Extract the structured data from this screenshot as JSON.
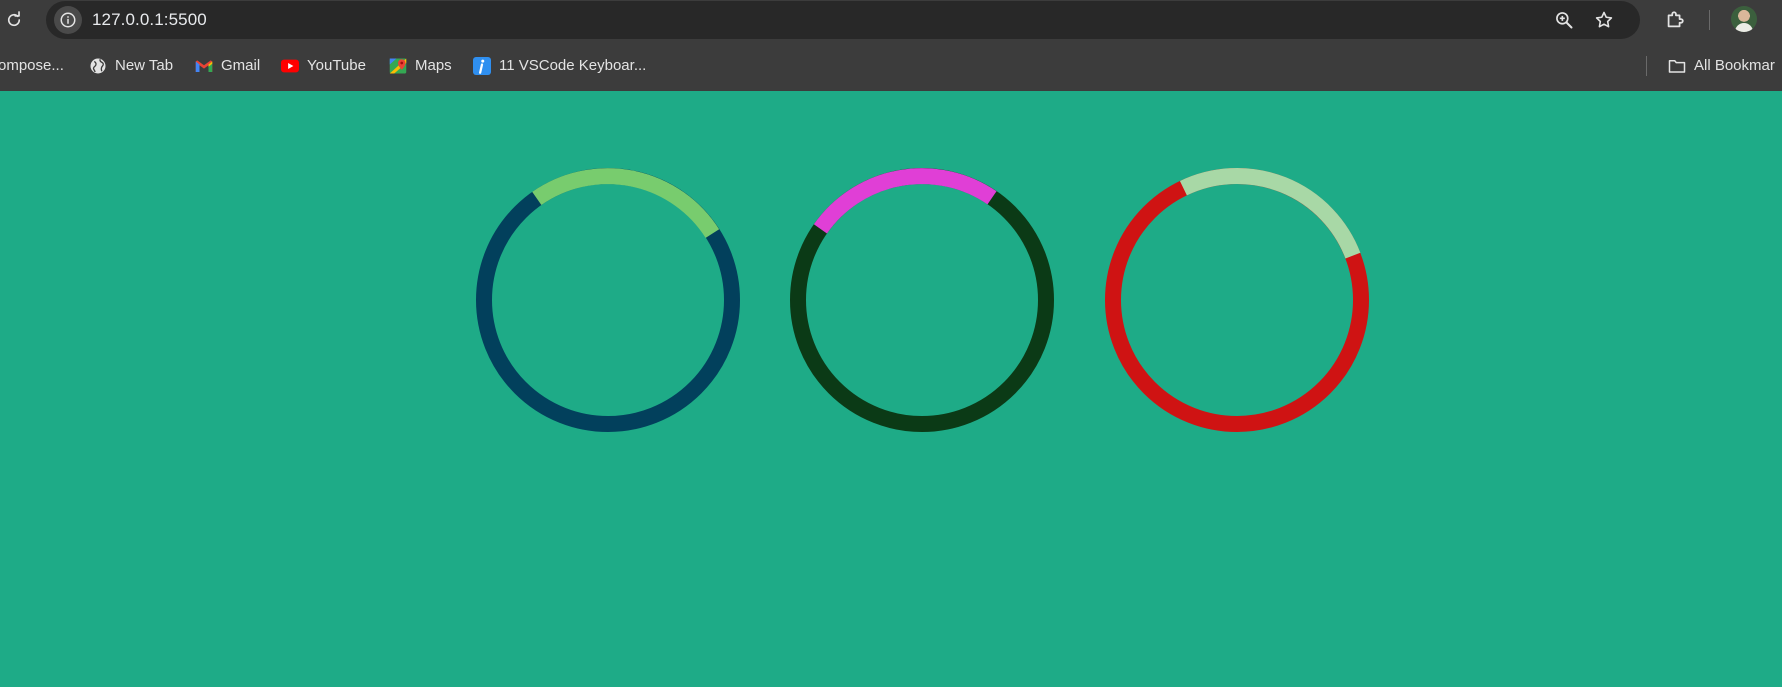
{
  "browser": {
    "url": "127.0.0.1:5500",
    "icons": {
      "reload": "reload-icon",
      "site_info": "info-icon",
      "zoom": "zoom-in-icon",
      "bookmark_star": "star-icon",
      "extensions": "puzzle-icon",
      "profile": "avatar"
    }
  },
  "bookmarks": {
    "items": [
      {
        "label": "ompose...",
        "icon": "compose-icon"
      },
      {
        "label": "New Tab",
        "icon": "globe-icon"
      },
      {
        "label": "Gmail",
        "icon": "gmail-icon"
      },
      {
        "label": "YouTube",
        "icon": "youtube-icon"
      },
      {
        "label": "Maps",
        "icon": "maps-icon"
      },
      {
        "label": "11 VSCode Keyboar...",
        "icon": "info-tile-icon"
      }
    ],
    "all_bookmarks": {
      "label": "All Bookmar",
      "icon": "folder-icon"
    }
  },
  "page": {
    "background": "#1eab87",
    "spinners": [
      {
        "name": "spinner-1",
        "track_color": "#02405c",
        "arc_color": "#78cc6e"
      },
      {
        "name": "spinner-2",
        "track_color": "#0b3a16",
        "arc_color": "#e03fd6"
      },
      {
        "name": "spinner-3",
        "track_color": "#cf1313",
        "arc_color": "#a8d8a6"
      }
    ]
  }
}
